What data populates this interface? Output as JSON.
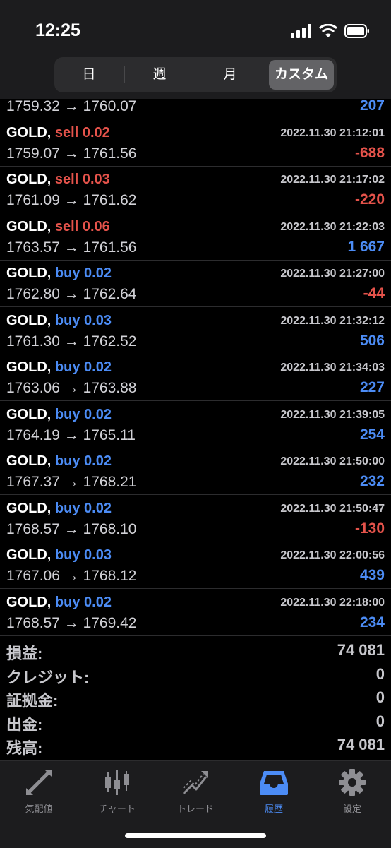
{
  "status_bar": {
    "time": "12:25"
  },
  "period_tabs": [
    {
      "label": "日",
      "active": false
    },
    {
      "label": "週",
      "active": false
    },
    {
      "label": "月",
      "active": false
    },
    {
      "label": "カスタム",
      "active": true
    }
  ],
  "trades": [
    {
      "symbol": "",
      "side": "",
      "volume": "",
      "time": "",
      "prices": "1759.32 → 1760.07",
      "profit": "207",
      "profit_sign": "pos"
    },
    {
      "symbol": "GOLD,",
      "side": "sell",
      "volume": "0.02",
      "time": "2022.11.30 21:12:01",
      "prices": "1759.07 → 1761.56",
      "profit": "-688",
      "profit_sign": "neg"
    },
    {
      "symbol": "GOLD,",
      "side": "sell",
      "volume": "0.03",
      "time": "2022.11.30 21:17:02",
      "prices": "1761.09 → 1761.62",
      "profit": "-220",
      "profit_sign": "neg"
    },
    {
      "symbol": "GOLD,",
      "side": "sell",
      "volume": "0.06",
      "time": "2022.11.30 21:22:03",
      "prices": "1763.57 → 1761.56",
      "profit": "1 667",
      "profit_sign": "pos"
    },
    {
      "symbol": "GOLD,",
      "side": "buy",
      "volume": "0.02",
      "time": "2022.11.30 21:27:00",
      "prices": "1762.80 → 1762.64",
      "profit": "-44",
      "profit_sign": "neg"
    },
    {
      "symbol": "GOLD,",
      "side": "buy",
      "volume": "0.03",
      "time": "2022.11.30 21:32:12",
      "prices": "1761.30 → 1762.52",
      "profit": "506",
      "profit_sign": "pos"
    },
    {
      "symbol": "GOLD,",
      "side": "buy",
      "volume": "0.02",
      "time": "2022.11.30 21:34:03",
      "prices": "1763.06 → 1763.88",
      "profit": "227",
      "profit_sign": "pos"
    },
    {
      "symbol": "GOLD,",
      "side": "buy",
      "volume": "0.02",
      "time": "2022.11.30 21:39:05",
      "prices": "1764.19 → 1765.11",
      "profit": "254",
      "profit_sign": "pos"
    },
    {
      "symbol": "GOLD,",
      "side": "buy",
      "volume": "0.02",
      "time": "2022.11.30 21:50:00",
      "prices": "1767.37 → 1768.21",
      "profit": "232",
      "profit_sign": "pos"
    },
    {
      "symbol": "GOLD,",
      "side": "buy",
      "volume": "0.02",
      "time": "2022.11.30 21:50:47",
      "prices": "1768.57 → 1768.10",
      "profit": "-130",
      "profit_sign": "neg"
    },
    {
      "symbol": "GOLD,",
      "side": "buy",
      "volume": "0.03",
      "time": "2022.11.30 22:00:56",
      "prices": "1767.06 → 1768.12",
      "profit": "439",
      "profit_sign": "pos"
    },
    {
      "symbol": "GOLD,",
      "side": "buy",
      "volume": "0.02",
      "time": "2022.11.30 22:18:00",
      "prices": "1768.57 → 1769.42",
      "profit": "234",
      "profit_sign": "pos"
    }
  ],
  "summary": [
    {
      "label": "損益:",
      "value": "74 081"
    },
    {
      "label": "クレジット:",
      "value": "0"
    },
    {
      "label": "証拠金:",
      "value": "0"
    },
    {
      "label": "出金:",
      "value": "0"
    },
    {
      "label": "残高:",
      "value": "74 081"
    }
  ],
  "tab_bar": [
    {
      "label": "気配値",
      "icon": "arrows-icon",
      "active": false
    },
    {
      "label": "チャート",
      "icon": "candlestick-icon",
      "active": false
    },
    {
      "label": "トレード",
      "icon": "trend-icon",
      "active": false
    },
    {
      "label": "履歴",
      "icon": "inbox-icon",
      "active": true
    },
    {
      "label": "設定",
      "icon": "gear-icon",
      "active": false
    }
  ],
  "colors": {
    "sell": "#e5534b",
    "buy": "#4c8cf5",
    "active_tab": "#4c8cf5"
  }
}
